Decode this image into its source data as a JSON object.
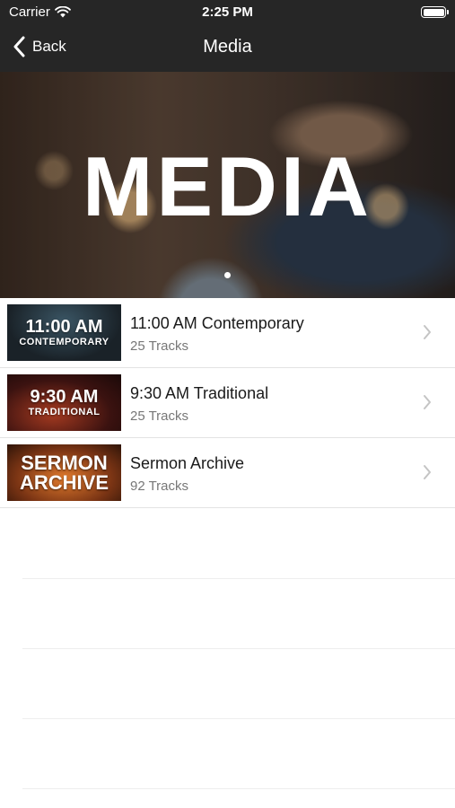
{
  "status_bar": {
    "carrier": "Carrier",
    "time": "2:25 PM"
  },
  "nav": {
    "back_label": "Back",
    "title": "Media"
  },
  "hero": {
    "title": "MEDIA",
    "page_count": 1,
    "current_page": 1
  },
  "items": [
    {
      "title": "11:00 AM Contemporary",
      "subtitle": "25 Tracks",
      "thumb_line1": "11:00 AM",
      "thumb_line2": "CONTEMPORARY"
    },
    {
      "title": "9:30 AM Traditional",
      "subtitle": "25 Tracks",
      "thumb_line1": "9:30 AM",
      "thumb_line2": "TRADITIONAL"
    },
    {
      "title": "Sermon Archive",
      "subtitle": "92 Tracks",
      "thumb_line1": "SERMON",
      "thumb_line2": "ARCHIVE"
    }
  ],
  "colors": {
    "bar_background": "#262626",
    "title_text": "#1a1a1a",
    "subtitle_text": "#777777",
    "separator": "#e3e3e3"
  }
}
